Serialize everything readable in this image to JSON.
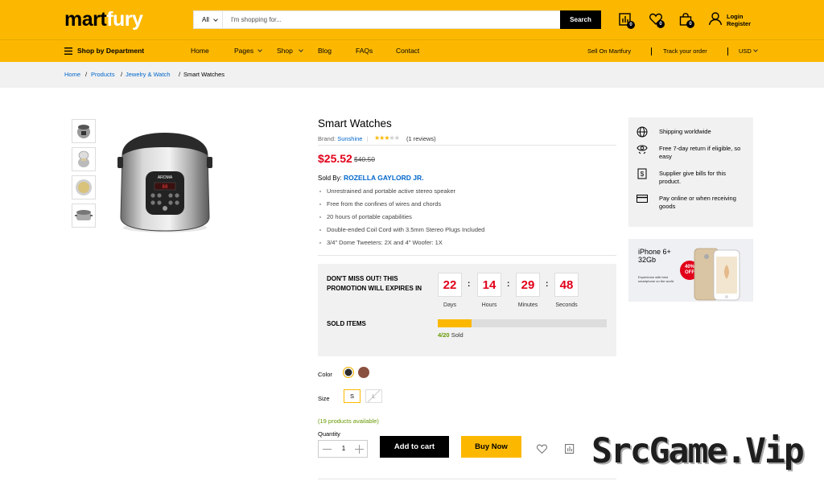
{
  "header": {
    "logo_part1": "mart",
    "logo_part2": "fury",
    "search_category": "All",
    "search_placeholder": "I'm shopping for...",
    "search_button": "Search",
    "compare_count": "0",
    "wishlist_count": "0",
    "cart_count": "0",
    "login_label": "Login",
    "register_label": "Register"
  },
  "nav": {
    "department": "Shop by Department",
    "items": [
      "Home",
      "Pages",
      "Shop",
      "Blog",
      "FAQs",
      "Contact"
    ],
    "sell": "Sell On Martfury",
    "track": "Track your order",
    "currency": "USD"
  },
  "breadcrumb": {
    "items": [
      "Home",
      "Products",
      "Jewelry & Watch",
      "Smart Watches"
    ]
  },
  "product": {
    "title": "Smart Watches",
    "brand_label": "Brand:",
    "brand": "Sunshine",
    "rating": 3,
    "rating_max": 5,
    "reviews": "(1 reviews)",
    "price": "$25.52",
    "old_price": "$40.50",
    "sold_by_label": "Sold By:",
    "seller": "ROZELLA GAYLORD JR.",
    "features": [
      "Unrestrained and portable active stereo speaker",
      "Free from the confines of wires and chords",
      "20 hours of portable capabilities",
      "Double-ended Coil Cord with 3.5mm Stereo Plugs Included",
      "3/4″ Dome Tweeters: 2X and 4″ Woofer: 1X"
    ],
    "promo_text": "DON'T MISS OUT! THIS PROMOTION WILL EXPIRES IN",
    "countdown": [
      {
        "value": "22",
        "label": "Days"
      },
      {
        "value": "14",
        "label": "Hours"
      },
      {
        "value": "29",
        "label": "Minutes"
      },
      {
        "value": "48",
        "label": "Seconds"
      }
    ],
    "sold_items_label": "SOLD ITEMS",
    "sold_count": "4/20",
    "sold_suffix": "Sold",
    "sold_fraction": 0.2,
    "color_label": "Color",
    "colors": [
      "#2b2b2b",
      "#8a5040"
    ],
    "size_label": "Size",
    "sizes": [
      "S",
      "L"
    ],
    "available": "(19 products available)",
    "quantity_label": "Quantity",
    "quantity": "1",
    "add_to_cart": "Add to cart",
    "buy_now": "Buy Now"
  },
  "sidebar": {
    "info": [
      {
        "icon": "globe-icon",
        "text": "Shipping worldwide"
      },
      {
        "icon": "return-icon",
        "text": "Free 7-day return if eligible, so easy"
      },
      {
        "icon": "receipt-icon",
        "text": "Supplier give bills for this product."
      },
      {
        "icon": "credit-card-icon",
        "text": "Pay online or when receiving goods"
      }
    ],
    "ad": {
      "title": "iPhone 6+ 32Gb",
      "badge_pct": "40%",
      "badge_off": "OFF",
      "subtitle": "Experience with best smartphone on the world"
    }
  },
  "watermark": "SrcGame.Vip",
  "colors": {
    "accent": "#fcb800",
    "price": "#e2001a",
    "link": "#0066cc",
    "stock": "#669900"
  }
}
